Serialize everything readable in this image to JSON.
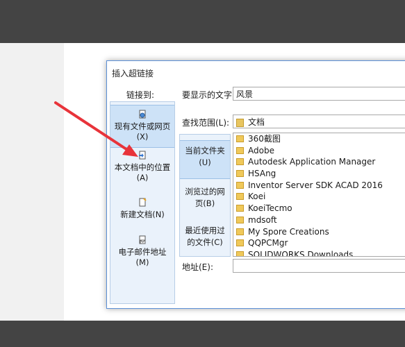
{
  "dialog": {
    "title": "插入超链接",
    "link_to_label": "链接到:",
    "display_text_label": "要显示的文字(T):",
    "display_text_value": "风景",
    "lookin_label": "查找范围(L):",
    "lookin_value": "文档",
    "address_label": "地址(E):",
    "address_value": ""
  },
  "link_to_items": [
    {
      "line1": "现有文件或网页",
      "line2": "(X)",
      "icon": "globe-file-icon"
    },
    {
      "line1": "本文档中的位置",
      "line2": "(A)",
      "icon": "document-place-icon"
    },
    {
      "line1": "新建文档(N)",
      "line2": "",
      "icon": "new-document-icon"
    },
    {
      "line1": "电子邮件地址",
      "line2": "(M)",
      "icon": "email-icon"
    }
  ],
  "browse_items": [
    {
      "line1": "当前文件夹",
      "line2": "(U)"
    },
    {
      "line1": "浏览过的网",
      "line2": "页(B)"
    },
    {
      "line1": "最近使用过",
      "line2": "的文件(C)"
    }
  ],
  "files": [
    "360截图",
    "Adobe",
    "Autodesk Application Manager",
    "HSAng",
    "Inventor Server SDK ACAD 2016",
    "Koei",
    "KoeiTecmo",
    "mdsoft",
    "My Spore Creations",
    "QQPCMgr",
    "SOLIDWORKS Downloads"
  ],
  "colors": {
    "annotation_arrow": "#e8333a",
    "dialog_border": "#5b8fd6",
    "selected_fill": "#cde2f7"
  }
}
